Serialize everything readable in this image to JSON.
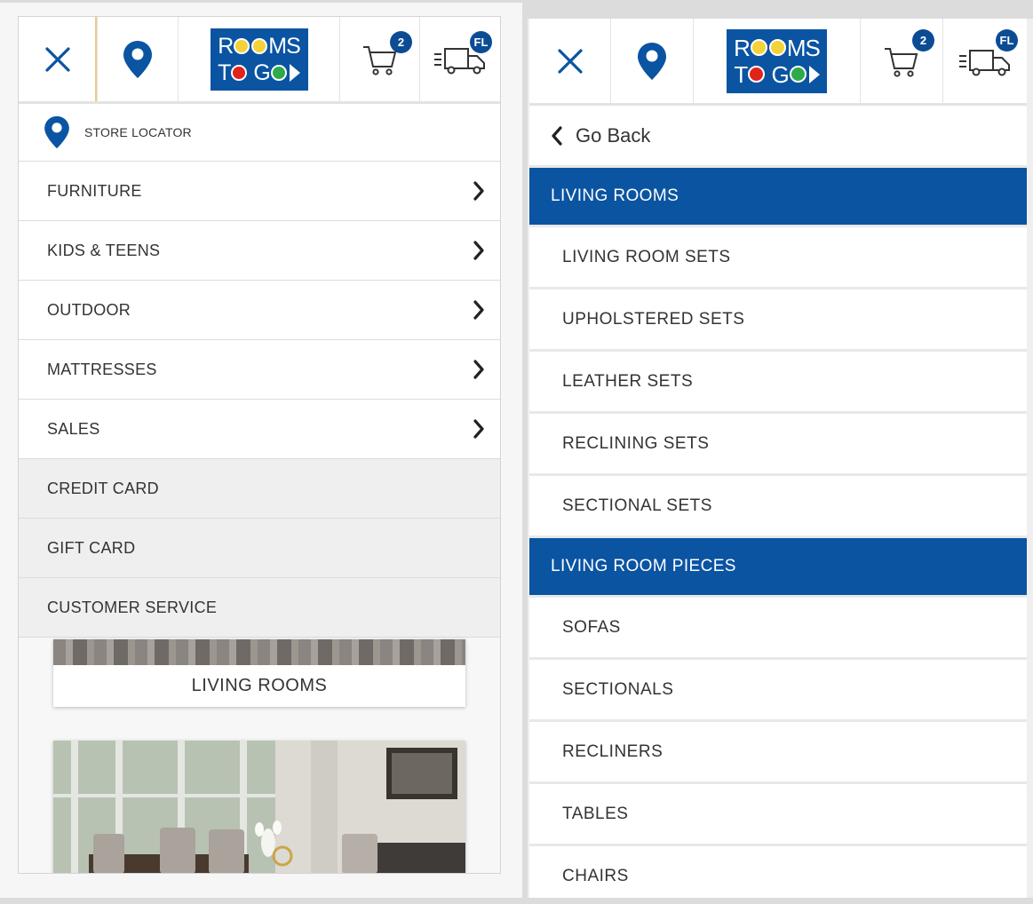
{
  "brand": {
    "line1": "ROOMS",
    "line2": "TO GO",
    "colors": {
      "blue": "#0a54a2",
      "yellow": "#f3d23a",
      "red": "#e2231a",
      "green": "#2eaa4a"
    }
  },
  "header": {
    "cart_count": "2",
    "delivery_state": "FL",
    "icons": [
      "close-icon",
      "location-pin-icon",
      "cart-icon",
      "delivery-truck-icon"
    ]
  },
  "left_menu": {
    "store_locator": "STORE LOCATOR",
    "items": [
      {
        "label": "FURNITURE",
        "has_submenu": true
      },
      {
        "label": "KIDS & TEENS",
        "has_submenu": true
      },
      {
        "label": "OUTDOOR",
        "has_submenu": true
      },
      {
        "label": "MATTRESSES",
        "has_submenu": true
      },
      {
        "label": "SALES",
        "has_submenu": true
      },
      {
        "label": "CREDIT CARD",
        "has_submenu": false
      },
      {
        "label": "GIFT CARD",
        "has_submenu": false
      },
      {
        "label": "CUSTOMER SERVICE",
        "has_submenu": false
      }
    ],
    "card_label": "LIVING ROOMS"
  },
  "right_menu": {
    "back_label": "Go Back",
    "sections": [
      {
        "title": "LIVING ROOMS",
        "items": [
          "LIVING ROOM SETS",
          "UPHOLSTERED SETS",
          "LEATHER SETS",
          "RECLINING SETS",
          "SECTIONAL SETS"
        ]
      },
      {
        "title": "LIVING ROOM PIECES",
        "items": [
          "SOFAS",
          "SECTIONALS",
          "RECLINERS",
          "TABLES",
          "CHAIRS"
        ]
      }
    ]
  }
}
